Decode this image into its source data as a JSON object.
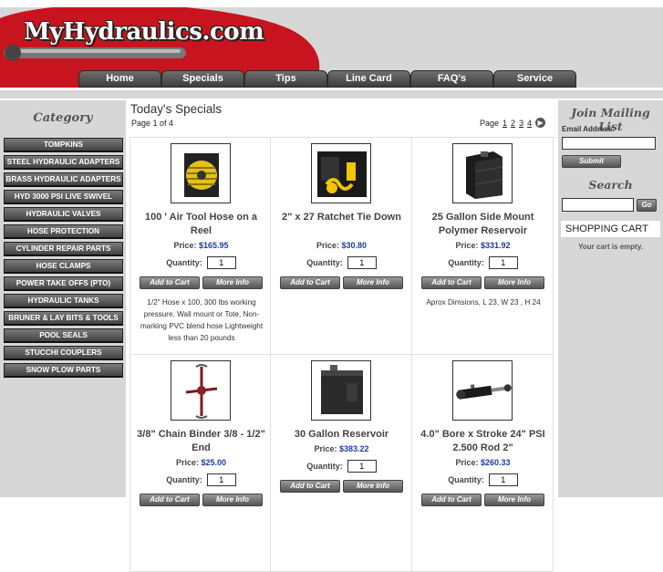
{
  "header": {
    "logo_text": "MyHydraulics.com",
    "nav": [
      "Home",
      "Specials",
      "Tips",
      "Line Card",
      "FAQ's",
      "Service"
    ]
  },
  "sidebar": {
    "title": "Category",
    "items": [
      "TOMPKINS",
      "STEEL HYDRAULIC ADAPTERS",
      "BRASS HYDRAULIC ADAPTERS",
      "HYD 3000 PSI LIVE SWIVEL",
      "HYDRAULIC VALVES",
      "HOSE PROTECTION",
      "CYLINDER REPAIR PARTS",
      "HOSE CLAMPS",
      "POWER TAKE OFFS (PTO)",
      "HYDRAULIC TANKS",
      "BRUNER & LAY BITS & TOOLS",
      "POOL SEALS",
      "STUCCHI COUPLERS",
      "SNOW PLOW PARTS"
    ]
  },
  "main": {
    "title": "Today's Specials",
    "page_info": "Page 1 of 4",
    "pager_label": "Page",
    "pages": [
      "1",
      "2",
      "3",
      "4"
    ],
    "labels": {
      "price": "Price:",
      "quantity": "Quantity:",
      "add_to_cart": "Add to Cart",
      "more_info": "More Info"
    },
    "products": [
      {
        "name": "100 ' Air Tool Hose on a Reel",
        "price": "$165.95",
        "qty": "1",
        "desc": "1/2\" Hose x 100, 300 lbs working pressure, Wall mount or Tote, Non-marking PVC blend hose Lightweight less than 20 pounds",
        "image": "hose-reel"
      },
      {
        "name": "2\" x 27 Ratchet Tie Down",
        "price": "$30.80",
        "qty": "1",
        "desc": "",
        "image": "ratchet-strap"
      },
      {
        "name": "25 Gallon Side Mount Polymer Reservoir",
        "price": "$331.92",
        "qty": "1",
        "desc": "Aprox Dimsions, L 23, W 23 , H 24",
        "image": "poly-reservoir"
      },
      {
        "name": "3/8\" Chain Binder 3/8 - 1/2\" End",
        "price": "$25.00",
        "qty": "1",
        "desc": "",
        "image": "chain-binder"
      },
      {
        "name": "30 Gallon Reservoir",
        "price": "$383.22",
        "qty": "1",
        "desc": "",
        "image": "steel-reservoir"
      },
      {
        "name": "4.0\" Bore x Stroke 24\" PSI 2.500 Rod 2\"",
        "price": "$260.33",
        "qty": "1",
        "desc": "",
        "image": "hydraulic-cylinder"
      }
    ]
  },
  "right": {
    "mailing_title": "Join Mailing List",
    "email_label": "Email Address:",
    "submit": "Submit",
    "search_title": "Search",
    "go": "Go",
    "cart_title": "SHOPPING CART",
    "cart_empty": "Your cart is empty."
  }
}
